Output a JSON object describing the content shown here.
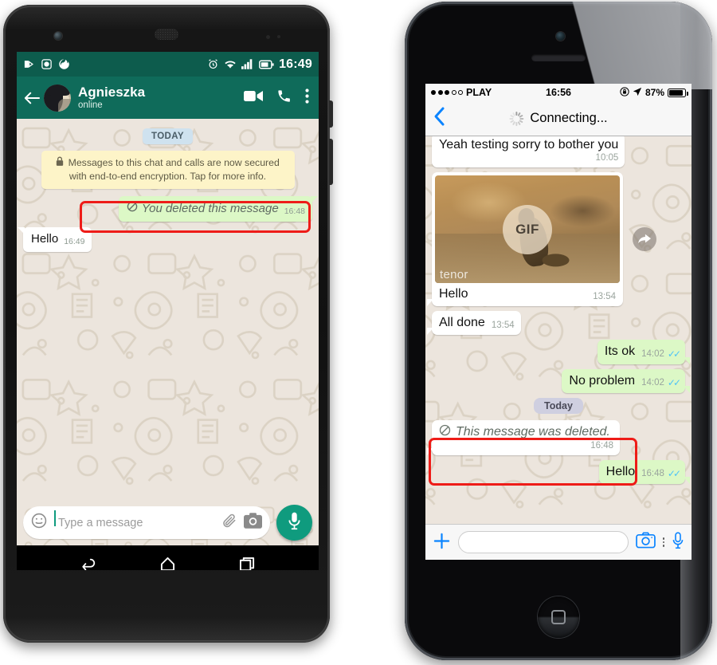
{
  "android": {
    "status_bar": {
      "icons": [
        "sim-card-icon",
        "camera-icon",
        "firefox-icon",
        "alarm-icon",
        "wifi-icon",
        "signal-icon",
        "battery-icon"
      ],
      "time": "16:49"
    },
    "app_bar": {
      "back_icon": "back-arrow-icon",
      "contact_name": "Agnieszka",
      "presence": "online",
      "video_call_icon": "video-camera-icon",
      "voice_call_icon": "phone-icon",
      "overflow_icon": "more-vertical-icon"
    },
    "chat": {
      "day_divider": "TODAY",
      "encryption_notice": "Messages to this chat and calls are now secured with end-to-end encryption. Tap for more info.",
      "encryption_lock_icon": "lock-icon",
      "messages": [
        {
          "direction": "out",
          "text": "You deleted this message",
          "time": "16:48",
          "deleted": true,
          "icon": "blocked-icon",
          "highlighted": true
        },
        {
          "direction": "in",
          "text": "Hello",
          "time": "16:49",
          "deleted": false,
          "highlighted": false
        }
      ]
    },
    "input_bar": {
      "emoji_icon": "emoji-smiley-icon",
      "placeholder": "Type a message",
      "value": "",
      "attach_icon": "paperclip-icon",
      "camera_icon": "camera-icon",
      "mic_icon": "microphone-icon",
      "mic_button_color": "#0f9b7e"
    },
    "nav_bar": {
      "back_icon": "nav-back-icon",
      "home_icon": "nav-home-icon",
      "recents_icon": "nav-recents-icon"
    }
  },
  "iphone": {
    "status_bar": {
      "signal_dots_filled": 3,
      "signal_dots_total": 5,
      "carrier": "PLAY",
      "time": "16:56",
      "rotation_lock_icon": "rotation-lock-icon",
      "location_icon": "location-arrow-icon",
      "battery_percent": "87%",
      "battery_icon": "battery-icon"
    },
    "nav_bar": {
      "back_icon": "back-chevron-icon",
      "title": "Connecting...",
      "spinner_icon": "loading-spinner-icon"
    },
    "chat": {
      "day_divider": "Today",
      "messages": [
        {
          "direction": "in",
          "text": "Yeah testing sorry to bother you",
          "time": "10:05",
          "type": "text"
        },
        {
          "direction": "in",
          "type": "gif",
          "gif_badge": "GIF",
          "gif_watermark": "tenor",
          "caption": "Hello",
          "time": "13:54",
          "forward_icon": "forward-arrow-icon"
        },
        {
          "direction": "in",
          "text": "All done",
          "time": "13:54",
          "type": "text"
        },
        {
          "direction": "out",
          "text": "Its ok",
          "time": "14:02",
          "type": "text",
          "ticks": "read"
        },
        {
          "direction": "out",
          "text": "No problem",
          "time": "14:02",
          "type": "text",
          "ticks": "read"
        },
        {
          "direction": "in",
          "text": "This message was deleted.",
          "time": "16:48",
          "type": "text",
          "deleted": true,
          "icon": "blocked-icon",
          "highlighted": true
        },
        {
          "direction": "out",
          "text": "Hello",
          "time": "16:48",
          "type": "text",
          "ticks": "read"
        }
      ]
    },
    "input_bar": {
      "plus_icon": "plus-icon",
      "placeholder": "",
      "value": "",
      "camera_icon": "camera-outline-icon",
      "more_icon": "more-vertical-icon",
      "mic_icon": "microphone-icon"
    },
    "home_button_icon": "home-button-icon"
  },
  "annotations": {
    "highlight_color": "#ee1c18",
    "boxes": [
      "android-deleted-message-highlight",
      "iphone-deleted-message-highlight"
    ]
  }
}
